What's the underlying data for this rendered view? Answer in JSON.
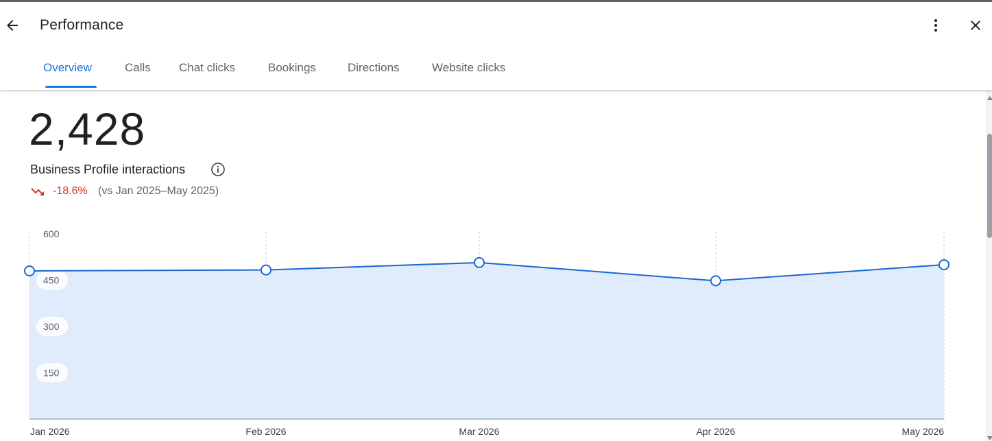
{
  "header": {
    "title": "Performance",
    "back_icon": "arrow-back-icon",
    "more_icon": "more-vert-icon",
    "close_icon": "close-icon"
  },
  "tabs": [
    {
      "label": "Overview",
      "active": true
    },
    {
      "label": "Calls",
      "active": false
    },
    {
      "label": "Chat clicks",
      "active": false
    },
    {
      "label": "Bookings",
      "active": false
    },
    {
      "label": "Directions",
      "active": false
    },
    {
      "label": "Website clicks",
      "active": false
    }
  ],
  "summary": {
    "total": "2,428",
    "label": "Business Profile interactions",
    "change": "-18.6%",
    "comparison": "(vs Jan 2025–May 2025)",
    "trend_icon": "trending-down-icon",
    "info_icon": "info-icon"
  },
  "colors": {
    "accent": "#1a73e8",
    "line": "#1967d2",
    "area_fill": "#e0ecfb",
    "negative": "#d93025"
  },
  "chart_data": {
    "type": "area",
    "categories": [
      "Jan 2026",
      "Feb 2026",
      "Mar 2026",
      "Apr 2026",
      "May 2026"
    ],
    "values": [
      480,
      483,
      507,
      448,
      500
    ],
    "y_ticks": [
      150,
      300,
      450,
      600
    ],
    "ylim": [
      0,
      600
    ],
    "grid": "vertical-dashed",
    "title": "",
    "xlabel": "",
    "ylabel": ""
  }
}
